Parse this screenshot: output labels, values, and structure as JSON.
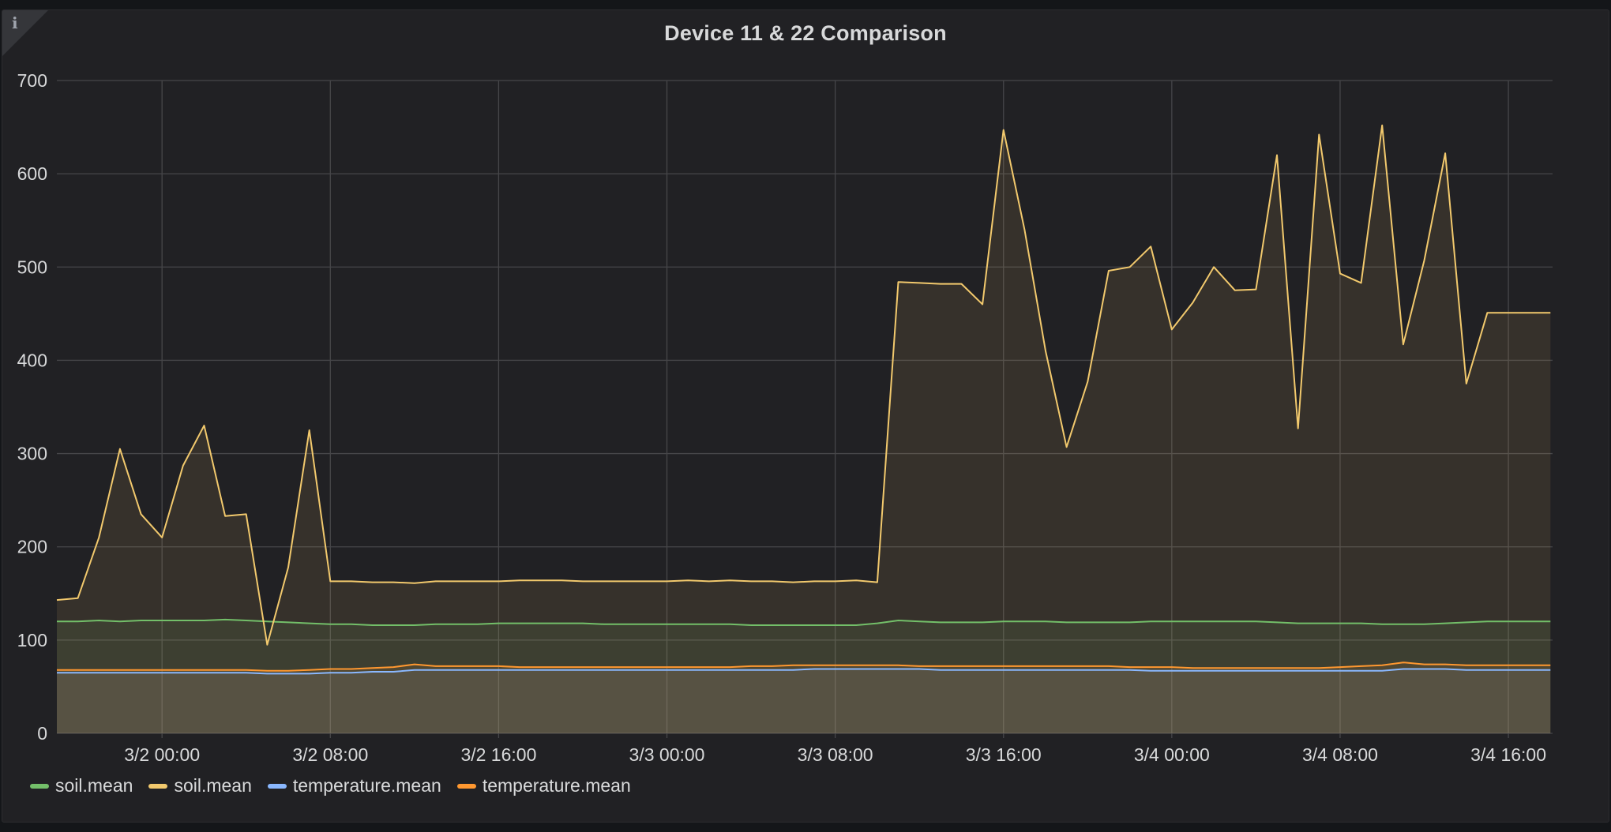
{
  "panel": {
    "title": "Device 11 & 22 Comparison",
    "info_glyph": "i"
  },
  "chart_data": {
    "type": "area",
    "title": "Device 11 & 22 Comparison",
    "x_unit": "datetime",
    "x_ticks": [
      "3/2 00:00",
      "3/2 08:00",
      "3/2 16:00",
      "3/3 00:00",
      "3/3 08:00",
      "3/3 16:00",
      "3/4 00:00",
      "3/4 08:00",
      "3/4 16:00"
    ],
    "x_tick_hours": [
      0,
      8,
      16,
      24,
      32,
      40,
      48,
      56,
      64
    ],
    "x_start_hour": -5,
    "x_end_hour": 66.1,
    "x_step_hours": 1,
    "y_ticks": [
      0,
      100,
      200,
      300,
      400,
      500,
      600,
      700
    ],
    "ylim": [
      0,
      700
    ],
    "grid": true,
    "legend_position": "bottom",
    "series": [
      {
        "name": "soil.mean",
        "color": "#73bf69",
        "values": [
          120,
          120,
          121,
          120,
          121,
          121,
          121,
          121,
          122,
          121,
          120,
          119,
          118,
          117,
          117,
          116,
          116,
          116,
          117,
          117,
          117,
          118,
          118,
          118,
          118,
          118,
          117,
          117,
          117,
          117,
          117,
          117,
          117,
          116,
          116,
          116,
          116,
          116,
          116,
          118,
          121,
          120,
          119,
          119,
          119,
          120,
          120,
          120,
          119,
          119,
          119,
          119,
          120,
          120,
          120,
          120,
          120,
          120,
          119,
          118,
          118,
          118,
          118,
          117,
          117,
          117,
          118,
          119,
          120,
          120,
          120,
          120
        ]
      },
      {
        "name": "soil.mean",
        "color": "#f2c96d",
        "values": [
          143,
          145,
          210,
          305,
          235,
          210,
          287,
          330,
          233,
          235,
          95,
          178,
          325,
          163,
          163,
          162,
          162,
          161,
          163,
          163,
          163,
          163,
          164,
          164,
          164,
          163,
          163,
          163,
          163,
          163,
          164,
          163,
          164,
          163,
          163,
          162,
          163,
          163,
          164,
          162,
          484,
          483,
          482,
          482,
          460,
          647,
          540,
          410,
          307,
          377,
          496,
          500,
          522,
          433,
          462,
          500,
          475,
          476,
          620,
          327,
          642,
          493,
          483,
          652,
          417,
          507,
          622,
          375,
          451,
          451,
          451,
          451
        ]
      },
      {
        "name": "temperature.mean",
        "color": "#8ab8ff",
        "values": [
          65,
          65,
          65,
          65,
          65,
          65,
          65,
          65,
          65,
          65,
          64,
          64,
          64,
          65,
          65,
          66,
          66,
          68,
          68,
          68,
          68,
          68,
          68,
          68,
          68,
          68,
          68,
          68,
          68,
          68,
          68,
          68,
          68,
          68,
          68,
          68,
          69,
          69,
          69,
          69,
          69,
          69,
          68,
          68,
          68,
          68,
          68,
          68,
          68,
          68,
          68,
          68,
          67,
          67,
          67,
          67,
          67,
          67,
          67,
          67,
          67,
          67,
          67,
          67,
          69,
          69,
          69,
          68,
          68,
          68,
          68,
          68
        ]
      },
      {
        "name": "temperature.mean",
        "color": "#ff9830",
        "values": [
          68,
          68,
          68,
          68,
          68,
          68,
          68,
          68,
          68,
          68,
          67,
          67,
          68,
          69,
          69,
          70,
          71,
          74,
          72,
          72,
          72,
          72,
          71,
          71,
          71,
          71,
          71,
          71,
          71,
          71,
          71,
          71,
          71,
          72,
          72,
          73,
          73,
          73,
          73,
          73,
          73,
          72,
          72,
          72,
          72,
          72,
          72,
          72,
          72,
          72,
          72,
          71,
          71,
          71,
          70,
          70,
          70,
          70,
          70,
          70,
          70,
          71,
          72,
          73,
          76,
          74,
          74,
          73,
          73,
          73,
          73,
          73
        ]
      }
    ]
  }
}
